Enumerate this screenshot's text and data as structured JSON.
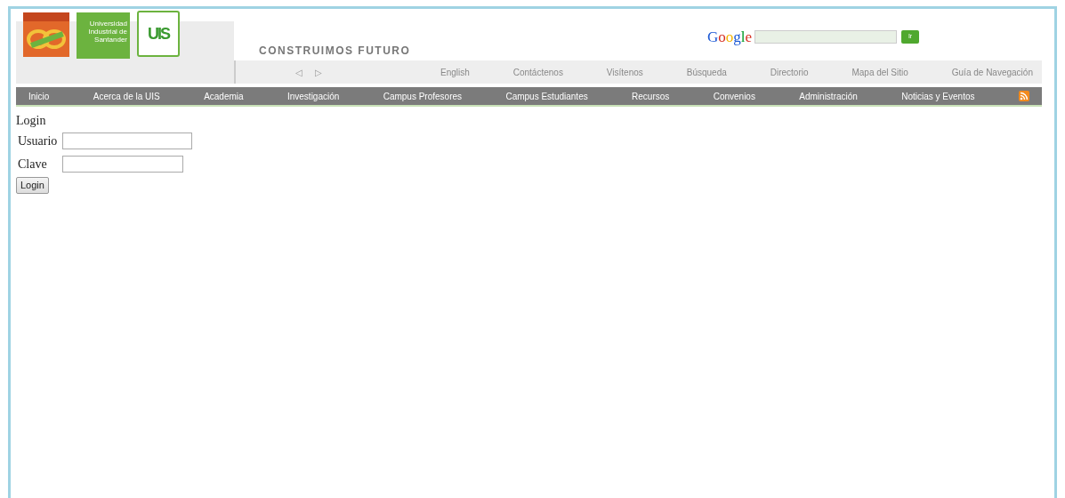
{
  "header": {
    "university_name": "Universidad Industrial de Santander",
    "logo_text": "UIS",
    "tagline": "CONSTRUIMOS FUTURO",
    "search": {
      "brand": "Google",
      "button": "Ir"
    },
    "slider_controls": [
      "◁",
      "▷"
    ],
    "top_links": [
      "English",
      "Contáctenos",
      "Visítenos",
      "Búsqueda",
      "Directorio",
      "Mapa del Sitio",
      "Guía de Navegación"
    ]
  },
  "nav": [
    "Inicio",
    "Acerca de la UIS",
    "Academia",
    "Investigación",
    "Campus Profesores",
    "Campus Estudiantes",
    "Recursos",
    "Convenios",
    "Administración",
    "Noticias y Eventos"
  ],
  "login": {
    "title": "Login",
    "fields": [
      {
        "label": "Usuario",
        "kind": "text"
      },
      {
        "label": "Clave",
        "kind": "password"
      }
    ],
    "button": "Login"
  }
}
